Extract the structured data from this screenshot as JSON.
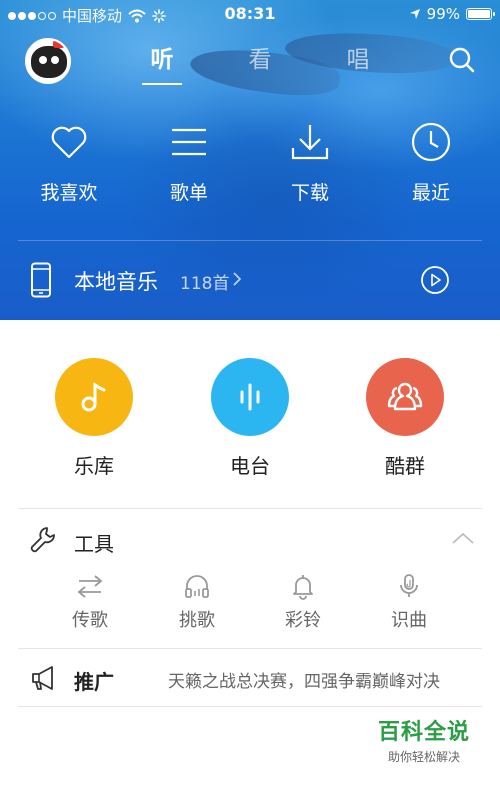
{
  "status_bar": {
    "carrier": "中国移动",
    "time": "08:31",
    "battery": "99%"
  },
  "header": {
    "tabs": [
      {
        "label": "听",
        "active": true
      },
      {
        "label": "看",
        "active": false
      },
      {
        "label": "唱",
        "active": false
      }
    ]
  },
  "quick_actions": [
    {
      "label": "我喜欢",
      "icon": "heart-icon"
    },
    {
      "label": "歌单",
      "icon": "list-icon"
    },
    {
      "label": "下载",
      "icon": "download-icon"
    },
    {
      "label": "最近",
      "icon": "clock-icon"
    }
  ],
  "local_music": {
    "title": "本地音乐",
    "count": "118首"
  },
  "main_entries": [
    {
      "label": "乐库",
      "icon": "music-note-icon",
      "color": "#F7B611"
    },
    {
      "label": "电台",
      "icon": "radio-wave-icon",
      "color": "#2BB6F2"
    },
    {
      "label": "酷群",
      "icon": "group-icon",
      "color": "#E8644D"
    }
  ],
  "tools": {
    "title": "工具",
    "items": [
      {
        "label": "传歌",
        "icon": "transfer-icon"
      },
      {
        "label": "挑歌",
        "icon": "headphones-icon"
      },
      {
        "label": "彩铃",
        "icon": "bell-icon"
      },
      {
        "label": "识曲",
        "icon": "mic-icon"
      }
    ]
  },
  "promo": {
    "title": "推广",
    "text": "天籁之战总决赛，四强争霸巅峰对决"
  },
  "watermark": {
    "line1": "百科全说",
    "line2": "助你轻松解决"
  },
  "colors": {
    "hero_blue": "#1E78D4",
    "watermark_green": "#2A9D45"
  }
}
